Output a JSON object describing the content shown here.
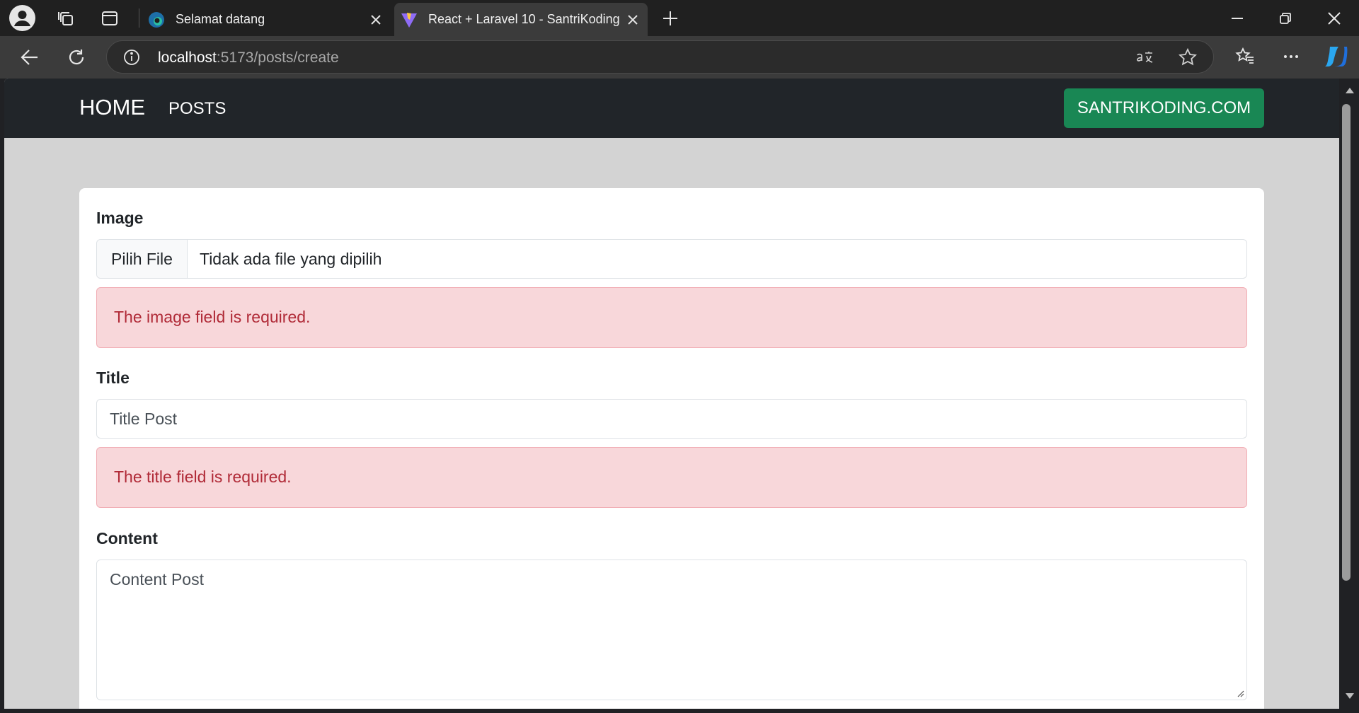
{
  "browser": {
    "tabs": [
      {
        "title": "Selamat datang"
      },
      {
        "title": "React + Laravel 10 - SantriKoding"
      }
    ],
    "url_host": "localhost",
    "url_path": ":5173/posts/create"
  },
  "navbar": {
    "brand": "HOME",
    "posts": "POSTS",
    "site_button": "SANTRIKODING.COM"
  },
  "form": {
    "image_label": "Image",
    "file_button": "Pilih File",
    "file_status": "Tidak ada file yang dipilih",
    "image_error": "The image field is required.",
    "title_label": "Title",
    "title_placeholder": "Title Post",
    "title_error": "The title field is required.",
    "content_label": "Content",
    "content_placeholder": "Content Post"
  },
  "colors": {
    "navbar_bg": "#212529",
    "accent_green": "#198754",
    "alert_bg": "#f8d7da",
    "alert_text": "#b02a37"
  }
}
